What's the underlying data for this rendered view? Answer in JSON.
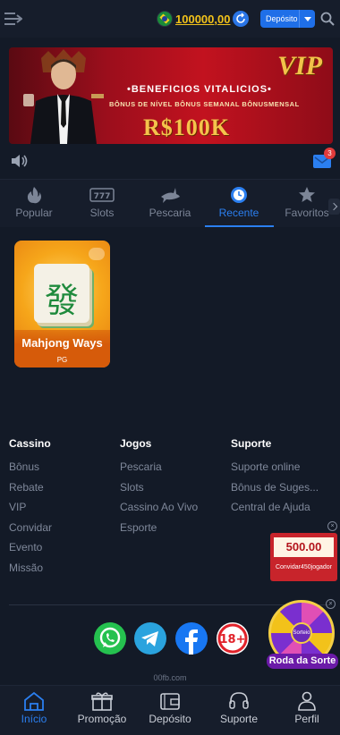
{
  "header": {
    "balance": "100000,00",
    "deposit_label": "Depósito"
  },
  "banner": {
    "vip": "VIP",
    "title": "•BENEFICIOS VITALICIOS•",
    "subtitle": "BÔNUS DE NÍVEL  BÔNUS SEMANAL  BÔNUSMENSAL",
    "amount": "R$100K"
  },
  "messages": {
    "badge": "3"
  },
  "tabs": [
    {
      "label": "Popular",
      "icon": "flame-icon"
    },
    {
      "label": "Slots",
      "icon": "slot-777-icon"
    },
    {
      "label": "Pescaria",
      "icon": "shark-icon"
    },
    {
      "label": "Recente",
      "icon": "clock-icon",
      "active": true
    },
    {
      "label": "Favoritos",
      "icon": "star-icon"
    }
  ],
  "game": {
    "name": "Mahjong Ways",
    "provider": "PG",
    "tile_char": "發"
  },
  "footer": {
    "cassino": {
      "title": "Cassino",
      "links": [
        "Bônus",
        "Rebate",
        "VIP",
        "Convidar",
        "Evento",
        "Missão"
      ]
    },
    "jogos": {
      "title": "Jogos",
      "links": [
        "Pescaria",
        "Slots",
        "Cassino Ao Vivo",
        "Esporte"
      ]
    },
    "suporte": {
      "title": "Suporte",
      "links": [
        "Suporte online",
        "Bônus de Suges...",
        "Central de Ajuda"
      ]
    }
  },
  "social": [
    "whatsapp-icon",
    "telegram-icon",
    "facebook-icon",
    "age-18-icon"
  ],
  "age_label": "18+",
  "site_url": "00fb.com",
  "floating": {
    "invite_amount": "500.00",
    "invite_label": "Convidar450jogador",
    "wheel_center": "Sorteio",
    "wheel_label": "Roda da Sorte"
  },
  "bottom_nav": [
    {
      "label": "Início",
      "active": true
    },
    {
      "label": "Promoção"
    },
    {
      "label": "Depósito"
    },
    {
      "label": "Suporte"
    },
    {
      "label": "Perfil"
    }
  ],
  "colors": {
    "background": "#131a27",
    "accent": "#2b7ff0",
    "balance": "#f2c21a"
  }
}
